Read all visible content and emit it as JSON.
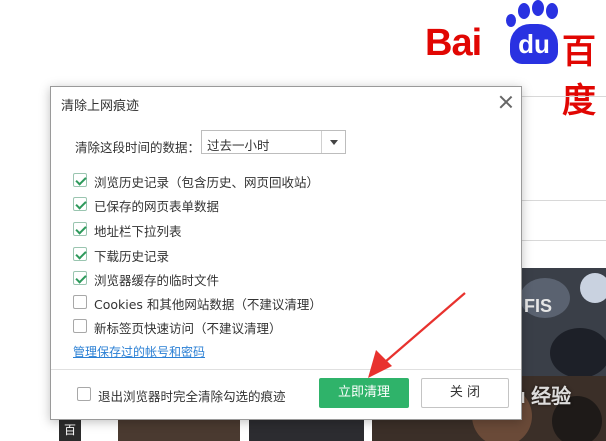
{
  "background": {
    "logo_bai": "Bai",
    "logo_du": "du",
    "logo_cn": "百度",
    "photo_text": "FIS",
    "side_label": "百",
    "watermark": "Baidu 经验"
  },
  "dialog": {
    "title": "清除上网痕迹",
    "range_label": "清除这段时间的数据：",
    "range_value": "过去一小时",
    "options": [
      {
        "label": "浏览历史记录（包含历史、网页回收站）",
        "checked": true
      },
      {
        "label": "已保存的网页表单数据",
        "checked": true
      },
      {
        "label": "地址栏下拉列表",
        "checked": true
      },
      {
        "label": "下载历史记录",
        "checked": true
      },
      {
        "label": "浏览器缓存的临时文件",
        "checked": true
      },
      {
        "label": "Cookies 和其他网站数据（不建议清理）",
        "checked": false
      },
      {
        "label": "新标签页快速访问（不建议清理）",
        "checked": false
      }
    ],
    "manage_link": "管理保存过的帐号和密码",
    "exit_clear_label": "退出浏览器时完全清除勾选的痕迹",
    "exit_clear_checked": false,
    "clear_button": "立即清理",
    "close_button": "关 闭"
  },
  "colors": {
    "primary": "#2fb36a",
    "link": "#2a7fd4",
    "annotation_arrow": "#e8322e"
  }
}
